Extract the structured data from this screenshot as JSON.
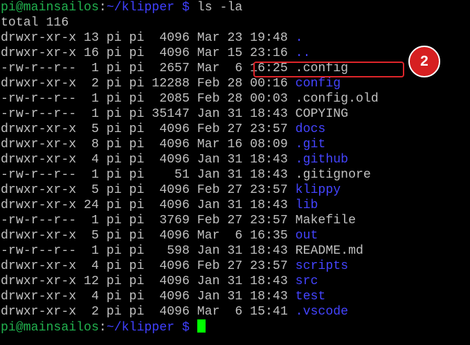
{
  "prompt": {
    "user_host": "pi@mainsailos",
    "separator": ":",
    "path": "~/klipper $",
    "command": " ls -la"
  },
  "total_line": "total 116",
  "entries": [
    {
      "meta": "drwxr-xr-x 13 pi pi  4096 Mar 23 19:48 ",
      "name": ".",
      "type": "dir"
    },
    {
      "meta": "drwxr-xr-x 16 pi pi  4096 Mar 15 23:16 ",
      "name": "..",
      "type": "dir"
    },
    {
      "meta": "-rw-r--r--  1 pi pi  2657 Mar  6 16:25 ",
      "name": ".config",
      "type": "file"
    },
    {
      "meta": "drwxr-xr-x  2 pi pi 12288 Feb 28 00:16 ",
      "name": "config",
      "type": "dir"
    },
    {
      "meta": "-rw-r--r--  1 pi pi  2085 Feb 28 00:03 ",
      "name": ".config.old",
      "type": "file"
    },
    {
      "meta": "-rw-r--r--  1 pi pi 35147 Jan 31 18:43 ",
      "name": "COPYING",
      "type": "file"
    },
    {
      "meta": "drwxr-xr-x  5 pi pi  4096 Feb 27 23:57 ",
      "name": "docs",
      "type": "dir"
    },
    {
      "meta": "drwxr-xr-x  8 pi pi  4096 Mar 16 08:09 ",
      "name": ".git",
      "type": "dir"
    },
    {
      "meta": "drwxr-xr-x  4 pi pi  4096 Jan 31 18:43 ",
      "name": ".github",
      "type": "dir"
    },
    {
      "meta": "-rw-r--r--  1 pi pi    51 Jan 31 18:43 ",
      "name": ".gitignore",
      "type": "file"
    },
    {
      "meta": "drwxr-xr-x  5 pi pi  4096 Feb 27 23:57 ",
      "name": "klippy",
      "type": "dir"
    },
    {
      "meta": "drwxr-xr-x 24 pi pi  4096 Jan 31 18:43 ",
      "name": "lib",
      "type": "dir"
    },
    {
      "meta": "-rw-r--r--  1 pi pi  3769 Feb 27 23:57 ",
      "name": "Makefile",
      "type": "file"
    },
    {
      "meta": "drwxr-xr-x  5 pi pi  4096 Mar  6 16:35 ",
      "name": "out",
      "type": "dir"
    },
    {
      "meta": "-rw-r--r--  1 pi pi   598 Jan 31 18:43 ",
      "name": "README.md",
      "type": "file"
    },
    {
      "meta": "drwxr-xr-x  4 pi pi  4096 Feb 27 23:57 ",
      "name": "scripts",
      "type": "dir"
    },
    {
      "meta": "drwxr-xr-x 12 pi pi  4096 Jan 31 18:43 ",
      "name": "src",
      "type": "dir"
    },
    {
      "meta": "drwxr-xr-x  4 pi pi  4096 Jan 31 18:43 ",
      "name": "test",
      "type": "dir"
    },
    {
      "meta": "drwxr-xr-x  2 pi pi  4096 Mar  6 15:41 ",
      "name": ".vscode",
      "type": "dir"
    }
  ],
  "annotation": {
    "badge_label": "2",
    "highlight_color": "#e0252a",
    "badge_color": "#d62021"
  },
  "colors": {
    "background": "#000000",
    "text": "#c0c0c0",
    "prompt_user": "#21b14e",
    "prompt_path": "#4040ff",
    "directory": "#4444ff",
    "cursor": "#00ff00"
  }
}
